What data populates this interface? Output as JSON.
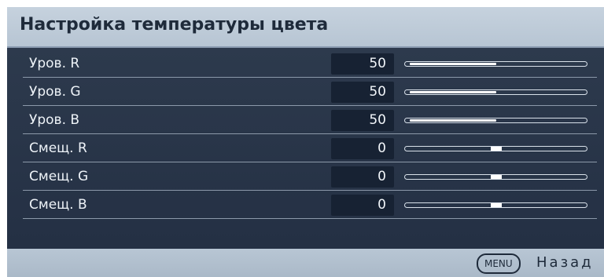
{
  "title": "Настройка температуры цвета",
  "rows": [
    {
      "label": "Уров. R",
      "value": "50",
      "level": 0.5,
      "kind": "bar"
    },
    {
      "label": "Уров. G",
      "value": "50",
      "level": 0.5,
      "kind": "bar"
    },
    {
      "label": "Уров. B",
      "value": "50",
      "level": 0.5,
      "kind": "bar"
    },
    {
      "label": "Смещ. R",
      "value": "0",
      "level": 0.5,
      "kind": "marker"
    },
    {
      "label": "Смещ. G",
      "value": "0",
      "level": 0.5,
      "kind": "marker"
    },
    {
      "label": "Смещ. B",
      "value": "0",
      "level": 0.5,
      "kind": "marker"
    }
  ],
  "footer": {
    "menu_key": "MENU",
    "back_label": "Назад"
  }
}
